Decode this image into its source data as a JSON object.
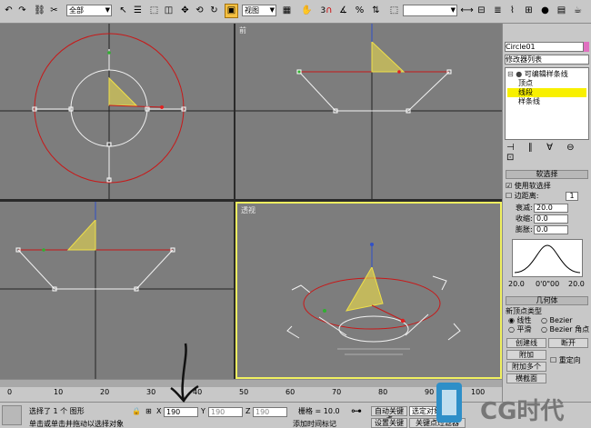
{
  "toolbar": {
    "filter_value": "全部",
    "view_value": "视图",
    "num_3": "3",
    "icons": [
      "undo-icon",
      "redo-icon",
      "link-icon",
      "unlink-icon",
      "bind-icon",
      "select-icon",
      "select-name-icon",
      "region-icon",
      "move-icon",
      "rotate-icon",
      "scale-icon",
      "snap-icon",
      "angle-snap-icon",
      "percent-snap-icon",
      "mirror-icon",
      "align-icon",
      "layer-icon",
      "curve-icon",
      "schematic-icon",
      "material-icon",
      "render-icon"
    ]
  },
  "viewports": {
    "top_label": "",
    "front_label": "前",
    "left_label": "",
    "persp_label": "透视"
  },
  "panel": {
    "object_name": "Circle01",
    "modifier_list": "修改器列表",
    "stack": [
      {
        "label": "可编辑样条线",
        "selected": false
      },
      {
        "label": "顶点",
        "selected": false
      },
      {
        "label": "线段",
        "selected": true
      },
      {
        "label": "样条线",
        "selected": false
      }
    ],
    "soft_select_title": "软选择",
    "use_soft_select": "使用软选择",
    "edge_distance": "边距离:",
    "edge_distance_value": "1",
    "falloff_label": "衰减:",
    "falloff_value": "20.0",
    "pinch_label": "收缩:",
    "pinch_value": "0.0",
    "bubble_label": "膨胀:",
    "bubble_value": "0.0",
    "curve_left": "20.0",
    "curve_mid": "0'0\"00",
    "curve_right": "20.0",
    "geometry_title": "几何体",
    "new_vertex_type": "新顶点类型",
    "linear": "线性",
    "bezier": "Bezier",
    "smooth": "平滑",
    "bezier_corner": "Bezier 角点",
    "create_line": "创建线",
    "break": "断开",
    "attach": "附加",
    "attach_multi": "附加多个",
    "reorient": "重定向",
    "cross_section": "横截面"
  },
  "timeline": {
    "ticks": [
      "0",
      "10",
      "20",
      "30",
      "40",
      "50",
      "60",
      "70",
      "80",
      "90",
      "100"
    ]
  },
  "status": {
    "selected_text": "选择了 1 个 图形",
    "prompt_text": "单击或单击并拖动以选择对象",
    "x_label": "X",
    "x_value": "190",
    "y_label": "Y",
    "y_value": "190",
    "z_label": "Z",
    "z_value": "190",
    "grid_text": "栅格 = 10.0",
    "add_time_tag": "添加时间标记",
    "auto_key": "自动关键点",
    "set_key": "设置关键点",
    "selected_obj": "选定对象",
    "key_filter": "关键点过滤器",
    "logo_text": "CG时代"
  },
  "colors": {
    "viewport_bg": "#7d7d7d",
    "active_border": "#f0f060",
    "spline_red": "#c81818",
    "spline_white": "#f2f2f2",
    "gizmo_yellow": "#f0e048",
    "selected_row": "#f8f000"
  }
}
